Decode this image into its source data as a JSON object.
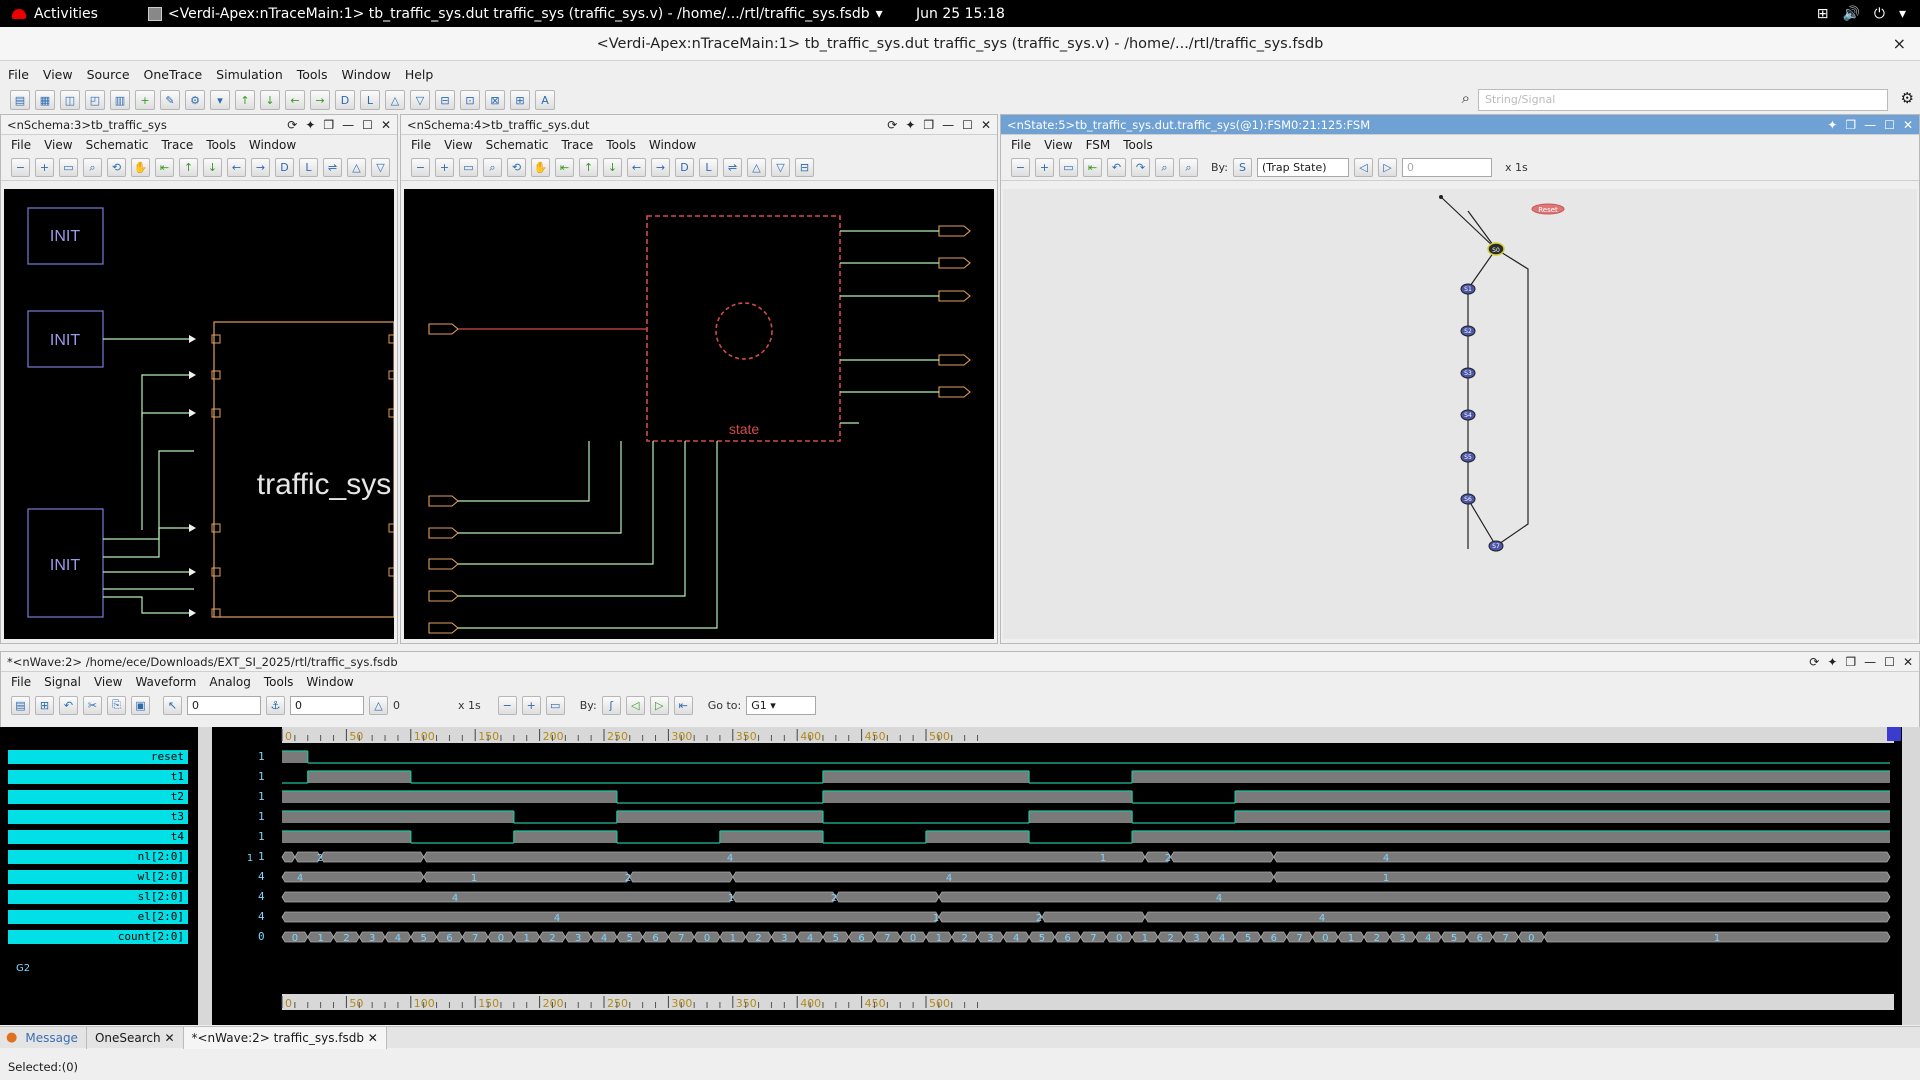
{
  "topbar": {
    "activities": "Activities",
    "app_title": "<Verdi-Apex:nTraceMain:1> tb_traffic_sys.dut traffic_sys (traffic_sys.v) - /home/.../rtl/traffic_sys.fsdb",
    "clock": "Jun 25  15:18"
  },
  "window": {
    "title": "<Verdi-Apex:nTraceMain:1> tb_traffic_sys.dut traffic_sys (traffic_sys.v) - /home/.../rtl/traffic_sys.fsdb",
    "close": "×"
  },
  "menubar": [
    "File",
    "View",
    "Source",
    "OneTrace",
    "Simulation",
    "Tools",
    "Window",
    "Help"
  ],
  "search": {
    "placeholder": "String/Signal"
  },
  "schema3": {
    "title": "<nSchema:3>tb_traffic_sys",
    "menu": [
      "File",
      "View",
      "Schematic",
      "Trace",
      "Tools",
      "Window"
    ],
    "init_labels": [
      "INIT",
      "INIT",
      "INIT"
    ],
    "module_label": "traffic_sys"
  },
  "schema4": {
    "title": "<nSchema:4>tb_traffic_sys.dut",
    "menu": [
      "File",
      "View",
      "Schematic",
      "Trace",
      "Tools",
      "Window"
    ],
    "state_label": "state"
  },
  "state5": {
    "title": "<nState:5>tb_traffic_sys.dut.traffic_sys(@1):FSM0:21:125:FSM",
    "menu": [
      "File",
      "View",
      "FSM",
      "Tools"
    ],
    "by_label": "By:",
    "trap_state": "(Trap State)",
    "value": "0",
    "scale": "x 1s",
    "states": [
      "S0",
      "S1",
      "S2",
      "S3",
      "S4",
      "S5",
      "S6",
      "S7"
    ],
    "reset_label": "Reset"
  },
  "wave": {
    "title": "*<nWave:2> /home/ece/Downloads/EXT_SI_2025/rtl/traffic_sys.fsdb",
    "menu": [
      "File",
      "Signal",
      "View",
      "Waveform",
      "Analog",
      "Tools",
      "Window"
    ],
    "cursor_value": "0",
    "marker_value": "0",
    "delta": "0",
    "scale": "x 1s",
    "by_label": "By:",
    "goto_label": "Go to:",
    "goto_value": "G1",
    "group_label": "G2",
    "ruler_ticks": [
      "0",
      "50",
      "100",
      "150",
      "200",
      "250",
      "300",
      "350",
      "400",
      "450",
      "500"
    ],
    "signals": [
      {
        "name": "reset",
        "value": "1"
      },
      {
        "name": "t1",
        "value": "1"
      },
      {
        "name": "t2",
        "value": "1"
      },
      {
        "name": "t3",
        "value": "1"
      },
      {
        "name": "t4",
        "value": "1"
      },
      {
        "name": "nl[2:0]",
        "value": "1"
      },
      {
        "name": "wl[2:0]",
        "value": "4"
      },
      {
        "name": "sl[2:0]",
        "value": "4"
      },
      {
        "name": "el[2:0]",
        "value": "4"
      },
      {
        "name": "count[2:0]",
        "value": "0"
      }
    ],
    "bus_labels": {
      "nl": [
        [
          "1",
          250
        ],
        [
          "2",
          320
        ],
        [
          "4",
          730
        ],
        [
          "1",
          1103
        ],
        [
          "2",
          1168
        ],
        [
          "4",
          1386
        ]
      ],
      "wl": [
        [
          "4",
          300
        ],
        [
          "1",
          474
        ],
        [
          "2",
          628
        ],
        [
          "4",
          949
        ],
        [
          "1",
          1386
        ]
      ],
      "sl": [
        [
          "4",
          455
        ],
        [
          "1",
          731
        ],
        [
          "2",
          834
        ],
        [
          "4",
          1219
        ]
      ],
      "el": [
        [
          "4",
          557
        ],
        [
          "1",
          936
        ],
        [
          "2",
          1039
        ],
        [
          "4",
          1322
        ]
      ]
    }
  },
  "tabs": [
    "Message",
    "OneSearch",
    "*<nWave:2> traffic_sys.fsdb"
  ],
  "status": "Selected:(0)"
}
